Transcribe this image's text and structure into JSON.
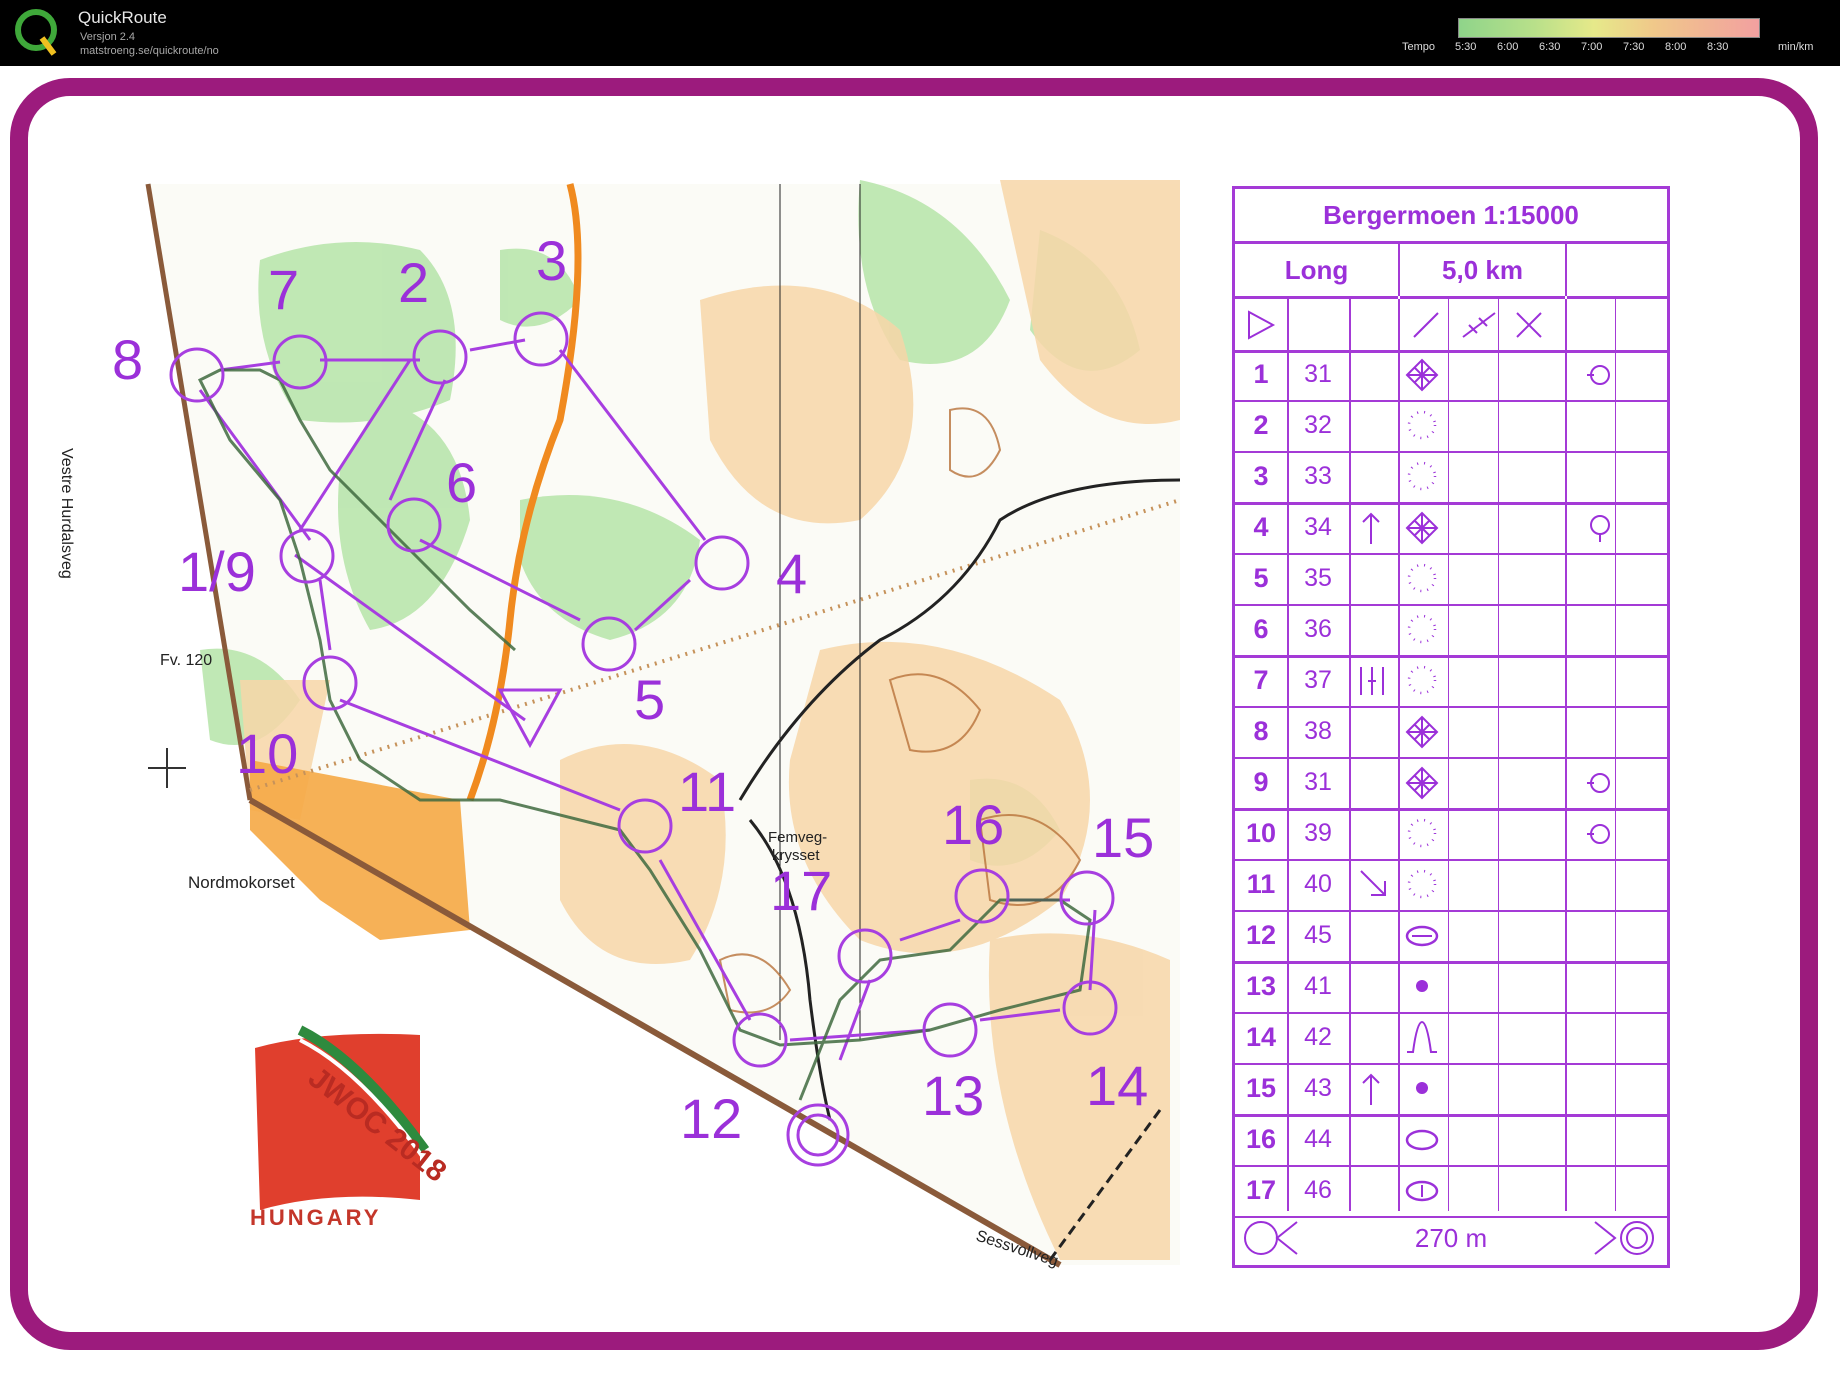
{
  "app": {
    "title": "QuickRoute",
    "version": "Versjon 2.4",
    "url": "matstroeng.se/quickroute/no"
  },
  "tempo": {
    "label": "Tempo",
    "ticks": [
      "5:30",
      "6:00",
      "6:30",
      "7:00",
      "7:30",
      "8:00",
      "8:30"
    ],
    "unit": "min/km"
  },
  "map": {
    "labels": {
      "road1": "Vestre Hurdalsveg",
      "road2": "Fv. 120",
      "place1": "Nordmokorset",
      "place2a": "Femveg-",
      "place2b": "krysset",
      "road3": "Sessvollveg",
      "logo_year": "JWOC 2018",
      "logo_country": "HUNGARY"
    },
    "controls": [
      "7",
      "2",
      "3",
      "8",
      "6",
      "1/9",
      "4",
      "5",
      "10",
      "11",
      "16",
      "15",
      "17",
      "12",
      "13",
      "14"
    ]
  },
  "description": {
    "title": "Bergermoen 1:15000",
    "class": "Long",
    "length": "5,0 km",
    "rows": [
      {
        "n": "1",
        "code": "31"
      },
      {
        "n": "2",
        "code": "32"
      },
      {
        "n": "3",
        "code": "33"
      },
      {
        "n": "4",
        "code": "34"
      },
      {
        "n": "5",
        "code": "35"
      },
      {
        "n": "6",
        "code": "36"
      },
      {
        "n": "7",
        "code": "37"
      },
      {
        "n": "8",
        "code": "38"
      },
      {
        "n": "9",
        "code": "31"
      },
      {
        "n": "10",
        "code": "39"
      },
      {
        "n": "11",
        "code": "40"
      },
      {
        "n": "12",
        "code": "45"
      },
      {
        "n": "13",
        "code": "41"
      },
      {
        "n": "14",
        "code": "42"
      },
      {
        "n": "15",
        "code": "43"
      },
      {
        "n": "16",
        "code": "44"
      },
      {
        "n": "17",
        "code": "46"
      }
    ],
    "finish_distance": "270 m"
  }
}
